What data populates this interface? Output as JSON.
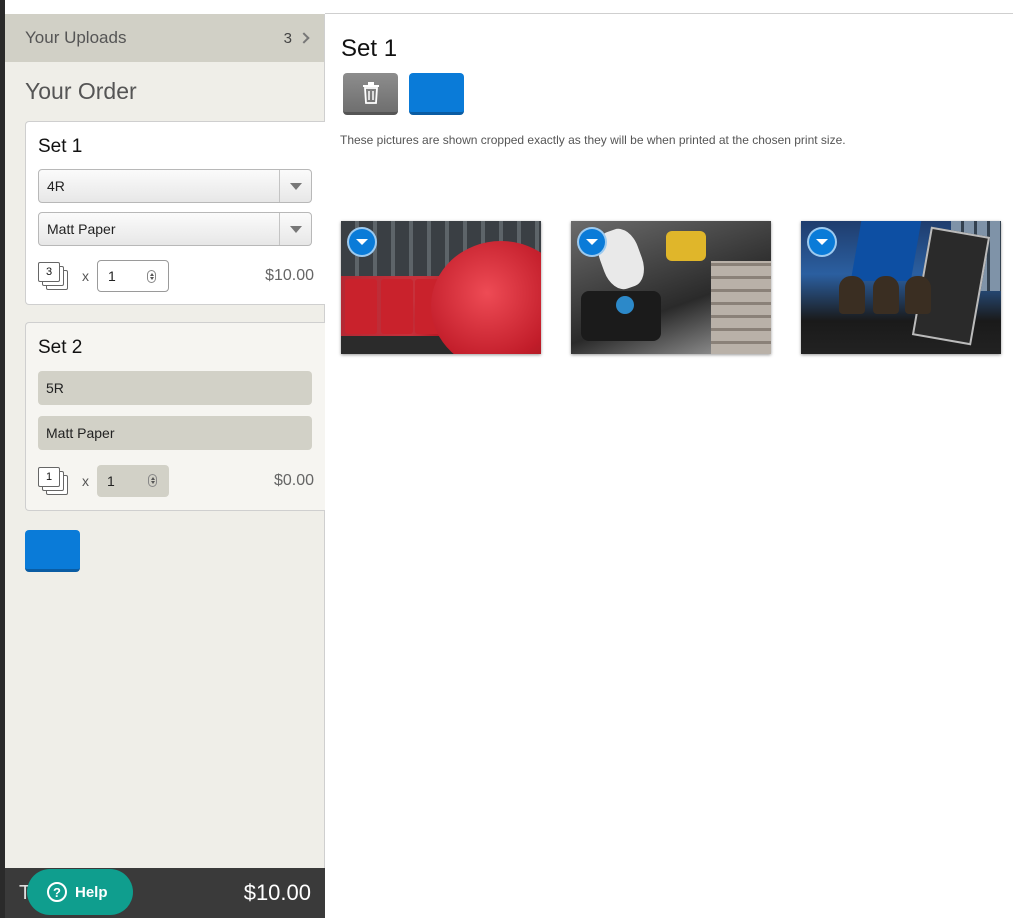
{
  "sidebar": {
    "uploads_label": "Your Uploads",
    "uploads_count": "3",
    "order_title": "Your Order",
    "sets": [
      {
        "title": "Set 1",
        "size": "4R",
        "paper": "Matt Paper",
        "photo_count": "3",
        "times": "x",
        "quantity": "1",
        "price": "$10.00"
      },
      {
        "title": "Set 2",
        "size": "5R",
        "paper": "Matt Paper",
        "photo_count": "1",
        "times": "x",
        "quantity": "1",
        "price": "$0.00"
      }
    ],
    "total_label": "T",
    "total_amount": "$10.00",
    "help_label": "Help",
    "help_icon": "?"
  },
  "main": {
    "title": "Set 1",
    "notice": "These pictures are shown cropped exactly as they will be when printed at the chosen print size.",
    "photos": [
      {
        "icon": "chevron-down-icon"
      },
      {
        "icon": "chevron-down-icon"
      },
      {
        "icon": "chevron-down-icon"
      }
    ]
  },
  "colors": {
    "accent_blue": "#0a7bd8",
    "help_teal": "#0f9e8e",
    "sidebar_bg": "#efeee8",
    "total_bar": "#3a3a3a"
  }
}
